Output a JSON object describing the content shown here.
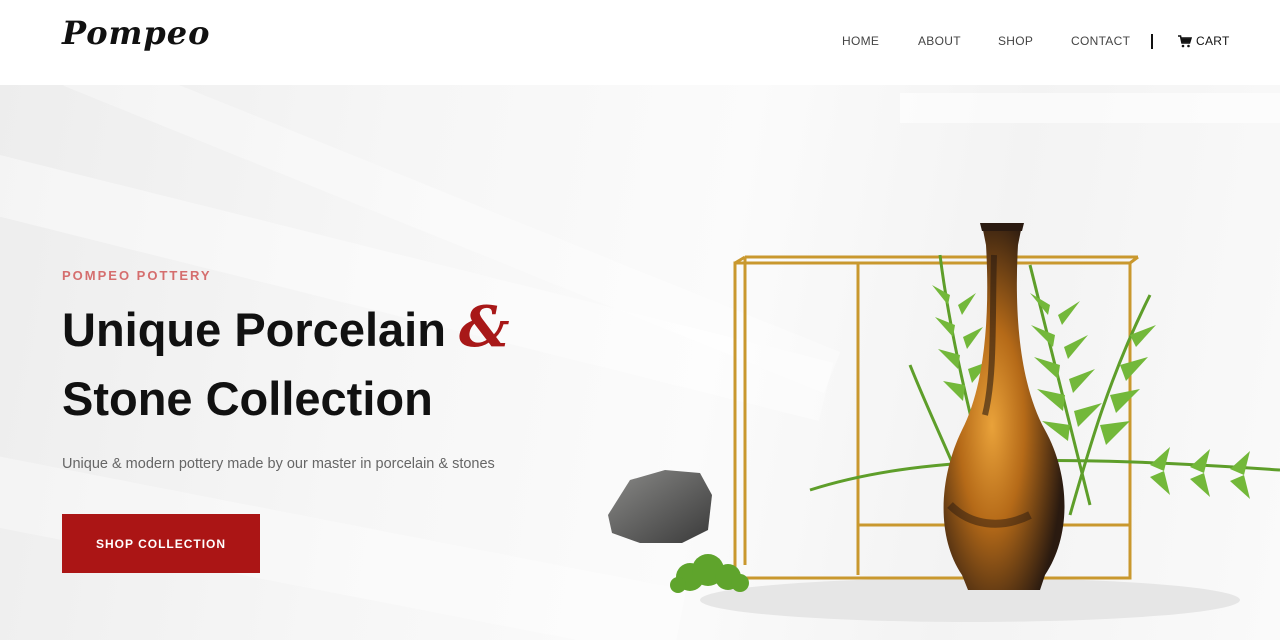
{
  "brand": {
    "logo_text": "Pompeo"
  },
  "nav": {
    "items": [
      {
        "label": "HOME"
      },
      {
        "label": "ABOUT"
      },
      {
        "label": "SHOP"
      },
      {
        "label": "CONTACT"
      }
    ],
    "cart_label": "CART",
    "cart_icon": "shopping-cart-icon"
  },
  "hero": {
    "eyebrow": "POMPEO POTTERY",
    "headline_line1": "Unique Porcelain",
    "ampersand": "&",
    "headline_line2": "Stone Collection",
    "subtitle": "Unique & modern pottery made by our master in porcelain & stones",
    "cta_label": "SHOP COLLECTION"
  },
  "colors": {
    "accent": "#ab1515",
    "eyebrow": "#d56e6e",
    "text_dark": "#111111",
    "text_muted": "#666666"
  }
}
